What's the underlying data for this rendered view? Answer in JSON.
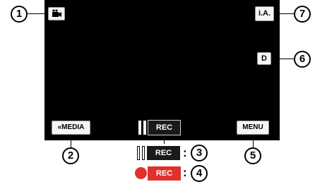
{
  "screen": {
    "media_button_label": "MEDIA",
    "media_chevron": "«",
    "rec_button_label": "REC",
    "menu_button_label": "MENU",
    "ia_label": "i.A.",
    "d_label": "D"
  },
  "callouts": {
    "c1": "1",
    "c2": "2",
    "c3": "3",
    "c4": "4",
    "c5": "5",
    "c6": "6",
    "c7": "7"
  },
  "legend": {
    "standby_label": "REC",
    "recording_label": "REC",
    "colon": ":"
  },
  "icons": {
    "mode_icon": "video-camera-icon",
    "pause_icon": "pause-icon",
    "record_dot": "record-dot-icon"
  },
  "colors": {
    "screen_bg": "#000000",
    "recording_red": "#e0312b",
    "tag_dark": "#1a1a1a"
  }
}
